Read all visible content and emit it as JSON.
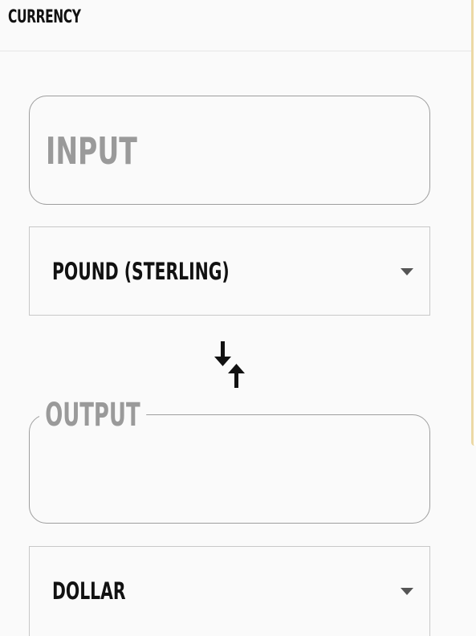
{
  "header": {
    "title": "CURRENCY"
  },
  "input": {
    "placeholder": "INPUT",
    "value": ""
  },
  "from_currency": {
    "selected": "POUND (STERLING)"
  },
  "swap": {
    "icon": "swap-vertical-icon"
  },
  "output": {
    "label": "OUTPUT",
    "value": ""
  },
  "to_currency": {
    "selected": "DOLLAR"
  },
  "colors": {
    "background": "#fafafa",
    "text": "#111111",
    "muted": "#9a9a9a",
    "accent_edge": "#ecd9a6"
  }
}
